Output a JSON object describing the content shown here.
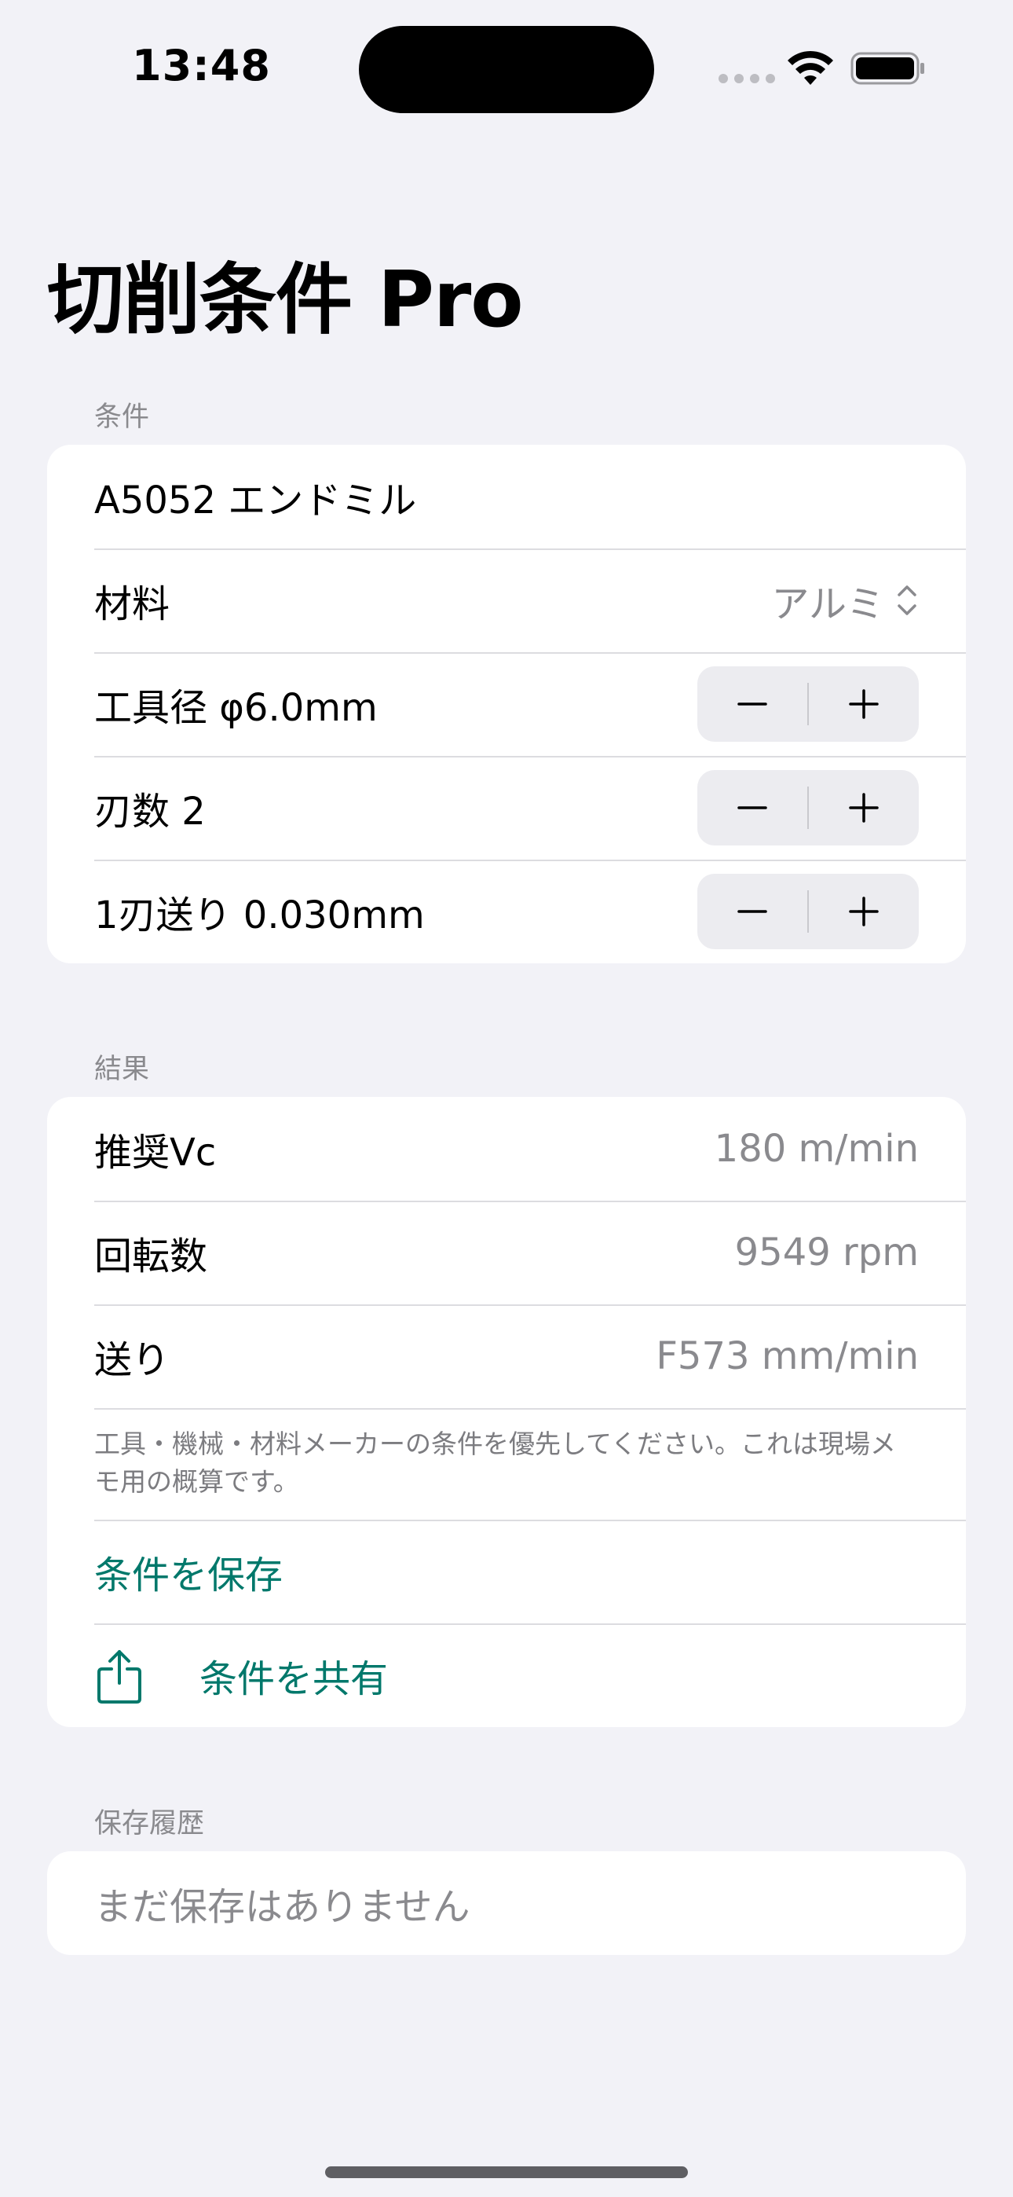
{
  "status_bar": {
    "time": "13:48"
  },
  "page": {
    "title": "切削条件 Pro"
  },
  "conditions": {
    "header": "条件",
    "name_value": "A5052 エンドミル",
    "material_label": "材料",
    "material_value": "アルミ",
    "tool_diameter_label": "工具径 φ6.0mm",
    "flutes_label": "刃数 2",
    "feed_per_tooth_label": "1刃送り 0.030mm",
    "stepper_minus": "−",
    "stepper_plus": "+"
  },
  "results": {
    "header": "結果",
    "vc_label": "推奨Vc",
    "vc_value": "180 m/min",
    "rpm_label": "回転数",
    "rpm_value": "9549 rpm",
    "feed_label": "送り",
    "feed_value": "F573 mm/min",
    "note": "工具・機械・材料メーカーの条件を優先してください。これは現場メモ用の概算です。",
    "save_label": "条件を保存",
    "share_label": "条件を共有"
  },
  "history": {
    "header": "保存履歴",
    "empty_text": "まだ保存はありません"
  },
  "colors": {
    "background": "#f2f2f7",
    "card": "#ffffff",
    "accent": "#00786b",
    "secondary_text": "#8a8a8e"
  },
  "icons": [
    "wifi-icon",
    "battery-icon",
    "chevron-updown-icon",
    "minus-icon",
    "plus-icon",
    "share-icon"
  ]
}
